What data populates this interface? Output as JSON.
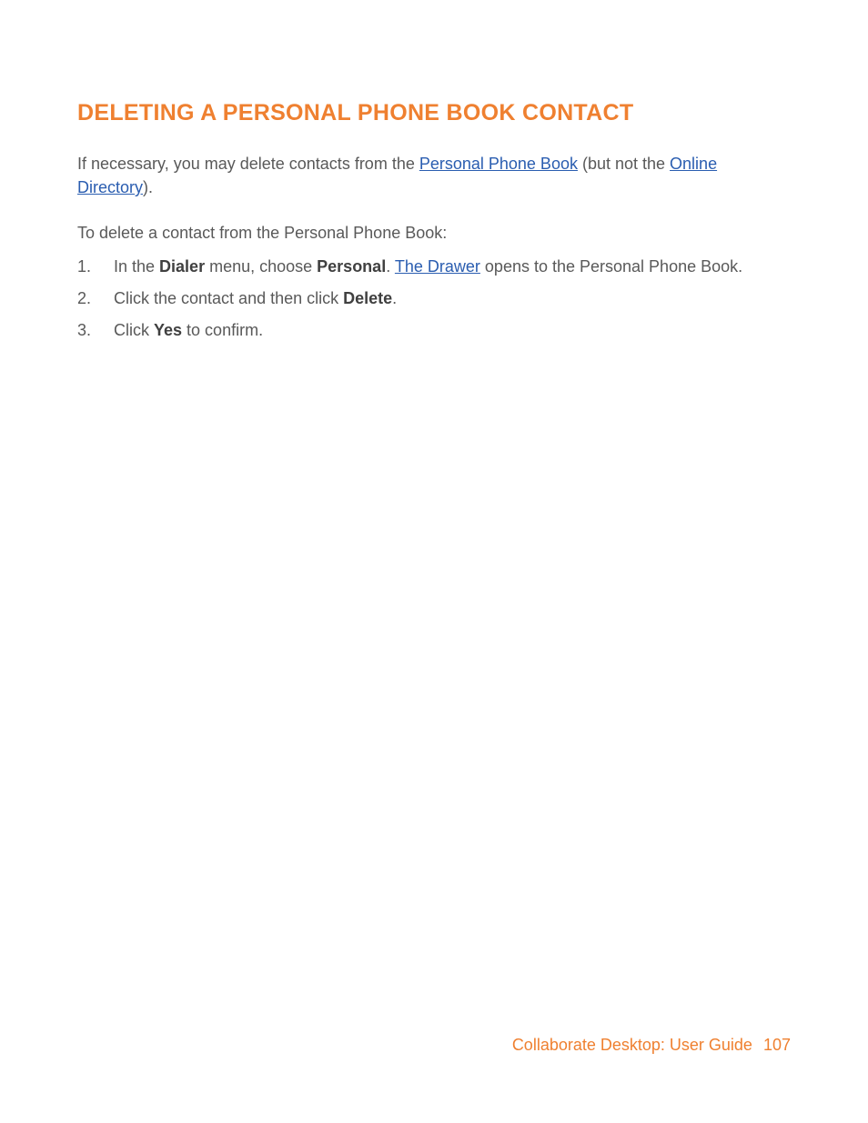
{
  "heading": "DELETING A PERSONAL PHONE BOOK CONTACT",
  "intro": {
    "pre": "If necessary, you may delete contacts from the ",
    "link1": "Personal Phone Book",
    "mid": " (but not the ",
    "link2": "Online Directory",
    "post": ")."
  },
  "subhead": "To delete a contact from the Personal Phone Book:",
  "steps": [
    {
      "t1": "In the ",
      "b1": "Dialer",
      "t2": " menu, choose ",
      "b2": "Personal",
      "t3": ". ",
      "link": "The Drawer",
      "t4": " opens to the Personal Phone Book."
    },
    {
      "t1": "Click the contact and then click ",
      "b1": "Delete",
      "t2": "."
    },
    {
      "t1": "Click ",
      "b1": "Yes",
      "t2": " to confirm."
    }
  ],
  "footer": {
    "title": "Collaborate Desktop: User Guide",
    "page": "107"
  }
}
